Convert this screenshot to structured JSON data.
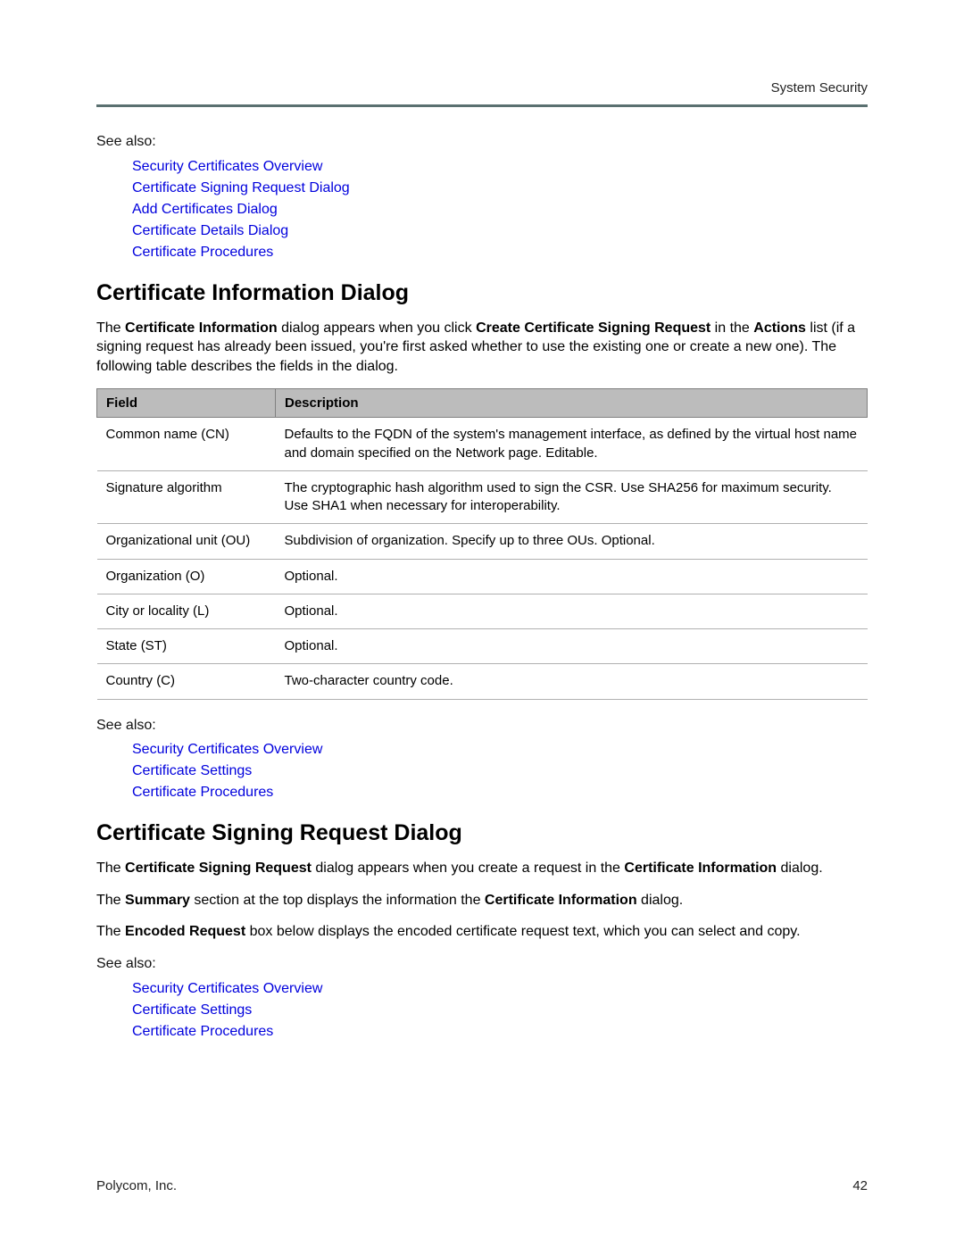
{
  "header": {
    "right": "System Security"
  },
  "seeAlso1": {
    "intro": "See also:",
    "links": [
      "Security Certificates Overview",
      "Certificate Signing Request Dialog",
      "Add Certificates Dialog",
      "Certificate Details Dialog",
      "Certificate Procedures"
    ]
  },
  "section1": {
    "heading": "Certificate Information Dialog",
    "para": {
      "t1": "The ",
      "b1": "Certificate Information",
      "t2": " dialog appears when you click ",
      "b2": "Create Certificate Signing Request",
      "t3": " in the ",
      "b3": "Actions",
      "t4": " list (if a signing request has already been issued, you're first asked whether to use the existing one or create a new one). The following table describes the fields in the dialog."
    },
    "table": {
      "headers": {
        "col1": "Field",
        "col2": "Description"
      },
      "rows": [
        {
          "field": "Common name (CN)",
          "desc": {
            "t1": "Defaults to the FQDN of the system's management interface, as defined by the virtual host name and domain specified on the ",
            "b1": "Network",
            "t2": " page. Editable."
          }
        },
        {
          "field": "Signature algorithm",
          "desc": {
            "t1": "The cryptographic hash algorithm used to sign the CSR. Use SHA256 for maximum security. Use SHA1 when necessary for interoperability.",
            "b1": "",
            "t2": ""
          }
        },
        {
          "field": "Organizational unit (OU)",
          "desc": {
            "t1": "Subdivision of organization. Specify up to three OUs. Optional.",
            "b1": "",
            "t2": ""
          }
        },
        {
          "field": "Organization (O)",
          "desc": {
            "t1": "Optional.",
            "b1": "",
            "t2": ""
          }
        },
        {
          "field": "City or locality (L)",
          "desc": {
            "t1": "Optional.",
            "b1": "",
            "t2": ""
          }
        },
        {
          "field": "State (ST)",
          "desc": {
            "t1": "Optional.",
            "b1": "",
            "t2": ""
          }
        },
        {
          "field": "Country (C)",
          "desc": {
            "t1": "Two-character country code.",
            "b1": "",
            "t2": ""
          }
        }
      ]
    }
  },
  "seeAlso2": {
    "intro": "See also:",
    "links": [
      "Security Certificates Overview",
      "Certificate Settings",
      "Certificate Procedures"
    ]
  },
  "section2": {
    "heading": "Certificate Signing Request Dialog",
    "para1": {
      "t1": "The ",
      "b1": "Certificate Signing Request",
      "t2": " dialog appears when you create a request in the ",
      "b2": "Certificate Information",
      "t3": " dialog."
    },
    "para2": {
      "t1": "The ",
      "b1": "Summary",
      "t2": " section at the top displays the information the ",
      "b2": "Certificate Information",
      "t3": " dialog."
    },
    "para3": {
      "t1": "The ",
      "b1": "Encoded Request",
      "t2": " box below displays the encoded certificate request text, which you can select and copy."
    }
  },
  "seeAlso3": {
    "intro": "See also:",
    "links": [
      "Security Certificates Overview",
      "Certificate Settings",
      "Certificate Procedures"
    ]
  },
  "footer": {
    "left": "Polycom, Inc.",
    "right": "42"
  }
}
